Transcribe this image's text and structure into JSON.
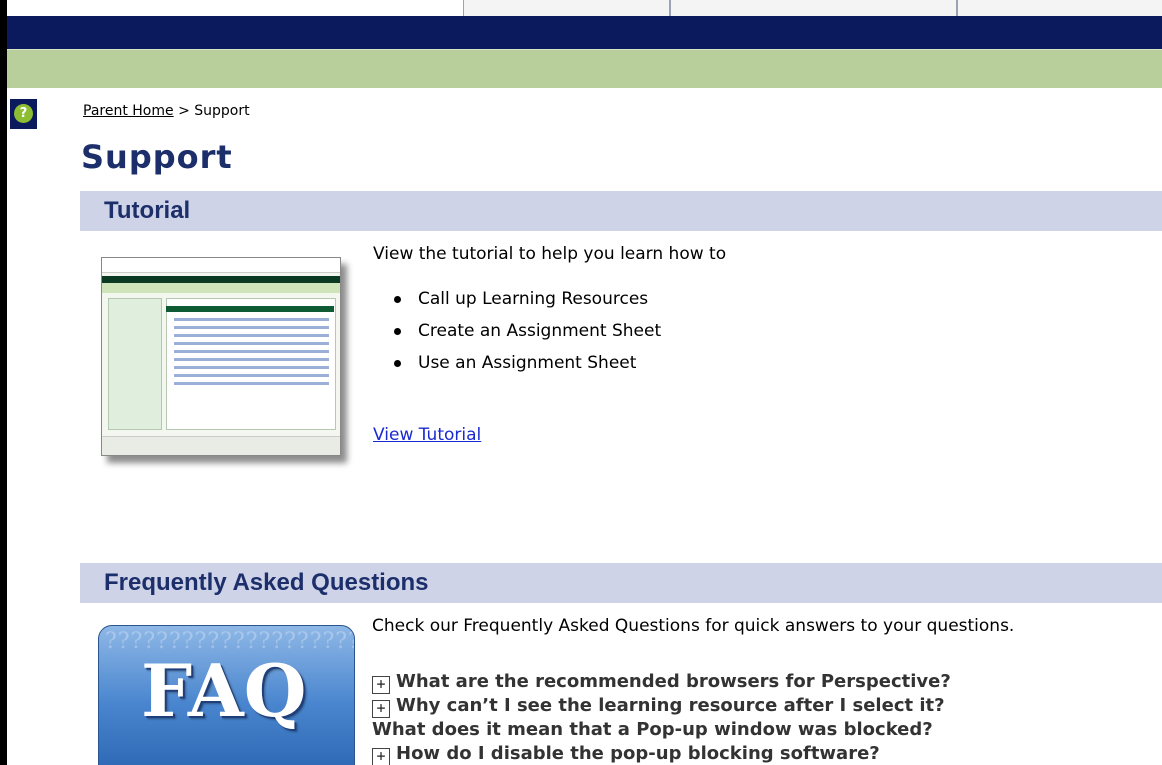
{
  "breadcrumb": {
    "parent_link": "Parent Home",
    "separator": " > ",
    "current": "Support"
  },
  "page": {
    "title": "Support"
  },
  "tutorial_section": {
    "title": "Tutorial",
    "intro": "View the tutorial to help you learn how to",
    "bullets": [
      "Call up Learning Resources",
      "Create an Assignment Sheet",
      "Use an Assignment Sheet"
    ],
    "link": "View Tutorial"
  },
  "faq_section": {
    "title": "Frequently Asked Questions",
    "image_text": "FAQ",
    "image_bg_text": "????????????????????????????????????????????????????????????????",
    "intro": "Check our Frequently Asked Questions for quick answers to your questions.",
    "expander_glyph": "+",
    "questions": [
      "What are the recommended browsers for Perspective?",
      "Why can’t I see the learning resource after I select it?",
      "What does it mean that a Pop-up window was blocked?",
      "How do I disable the pop-up blocking software?"
    ]
  },
  "icons": {
    "help": "?"
  },
  "colors": {
    "nav_bar": "#0a1a5c",
    "green_bar": "#b8cf9b",
    "section_header_bg": "#cfd3e7",
    "heading_text": "#1c2f6b",
    "link_blue": "#1a2ad0"
  }
}
